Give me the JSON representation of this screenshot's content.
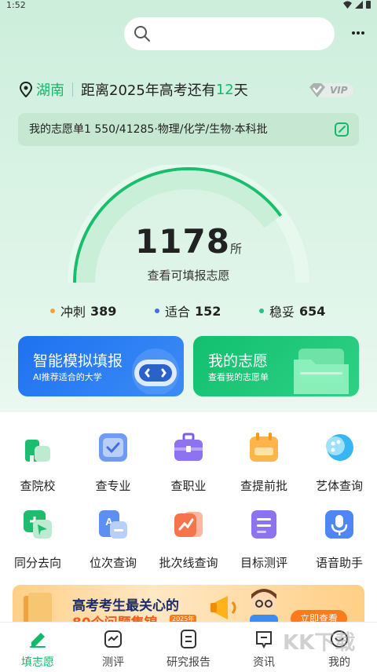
{
  "status": {
    "time": "1:52"
  },
  "header": {
    "search_placeholder": ""
  },
  "location": {
    "city": "湖南",
    "countdown_prefix": "距离2025年高考还有",
    "days": "12",
    "countdown_suffix": "天"
  },
  "vip": {
    "label": "VIP"
  },
  "plan": {
    "text": "我的志愿单1 550/41285·物理/化学/生物·本科批"
  },
  "summary": {
    "total": "1178",
    "unit": "所",
    "subtitle": "查看可填报志愿",
    "progress_fraction": 0.8
  },
  "stats": [
    {
      "label": "冲刺",
      "value": "389",
      "color": "#f5a13a"
    },
    {
      "label": "适合",
      "value": "152",
      "color": "#3b6ff1"
    },
    {
      "label": "稳妥",
      "value": "654",
      "color": "#21c28a"
    }
  ],
  "cards": {
    "simulate": {
      "title": "智能模拟填报",
      "subtitle": "AI推荐适合的大学"
    },
    "mine": {
      "title": "我的志愿",
      "subtitle": "查看我的志愿单"
    }
  },
  "grid": [
    {
      "label": "查院校",
      "icon": "school-icon"
    },
    {
      "label": "查专业",
      "icon": "major-icon"
    },
    {
      "label": "查职业",
      "icon": "briefcase-icon"
    },
    {
      "label": "查提前批",
      "icon": "calendar-icon"
    },
    {
      "label": "艺体查询",
      "icon": "palette-icon"
    },
    {
      "label": "同分去向",
      "icon": "flag-icon"
    },
    {
      "label": "位次查询",
      "icon": "rank-icon"
    },
    {
      "label": "批次线查询",
      "icon": "trend-icon"
    },
    {
      "label": "目标测评",
      "icon": "survey-icon"
    },
    {
      "label": "语音助手",
      "icon": "microphone-icon"
    }
  ],
  "banner": {
    "line1": "高考考生最关心的",
    "line2": "80个问题集锦",
    "year": "2025年",
    "button": "立即查看"
  },
  "tabs": [
    {
      "label": "填志愿",
      "active": true
    },
    {
      "label": "测评",
      "active": false
    },
    {
      "label": "研究报告",
      "active": false
    },
    {
      "label": "资讯",
      "active": false
    },
    {
      "label": "我的",
      "active": false
    }
  ],
  "watermark": "KK下载"
}
